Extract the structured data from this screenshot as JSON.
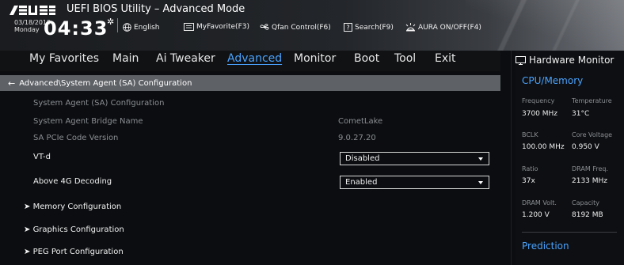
{
  "header": {
    "title": "UEFI BIOS Utility – Advanced Mode",
    "date": "03/18/2019",
    "day": "Monday",
    "time": "04:33",
    "tools": {
      "language": "English",
      "myfavorite": "MyFavorite(F3)",
      "qfan": "Qfan Control(F6)",
      "search": "Search(F9)",
      "aura": "AURA ON/OFF(F4)"
    },
    "logo_text": "ASUS"
  },
  "nav": {
    "items": [
      "My Favorites",
      "Main",
      "Ai Tweaker",
      "Advanced",
      "Monitor",
      "Boot",
      "Tool",
      "Exit"
    ],
    "active": "Advanced"
  },
  "breadcrumb": "Advanced\\System Agent (SA) Configuration",
  "settings": {
    "sa_config": "System Agent (SA) Configuration",
    "bridge_name_label": "System Agent Bridge Name",
    "bridge_name_value": "CometLake",
    "pcie_version_label": "SA PCIe Code Version",
    "pcie_version_value": "9.0.27.20",
    "vtd_label": "VT-d",
    "vtd_value": "Disabled",
    "above4g_label": "Above 4G Decoding",
    "above4g_value": "Enabled",
    "memory_config": "Memory Configuration",
    "graphics_config": "Graphics Configuration",
    "peg_config": "PEG Port Configuration"
  },
  "hardware_monitor": {
    "title": "Hardware Monitor",
    "cpu_memory": "CPU/Memory",
    "frequency_label": "Frequency",
    "frequency_value": "3700 MHz",
    "temperature_label": "Temperature",
    "temperature_value": "31°C",
    "bclk_label": "BCLK",
    "bclk_value": "100.00 MHz",
    "core_voltage_label": "Core Voltage",
    "core_voltage_value": "0.950 V",
    "ratio_label": "Ratio",
    "ratio_value": "37x",
    "dram_freq_label": "DRAM Freq.",
    "dram_freq_value": "2133 MHz",
    "dram_volt_label": "DRAM Volt.",
    "dram_volt_value": "1.200 V",
    "capacity_label": "Capacity",
    "capacity_value": "8192 MB",
    "prediction": "Prediction"
  },
  "colors": {
    "accent": "#4aa3ff",
    "background": "#0b0d10",
    "breadcrumb_bg": "#5e6166"
  }
}
